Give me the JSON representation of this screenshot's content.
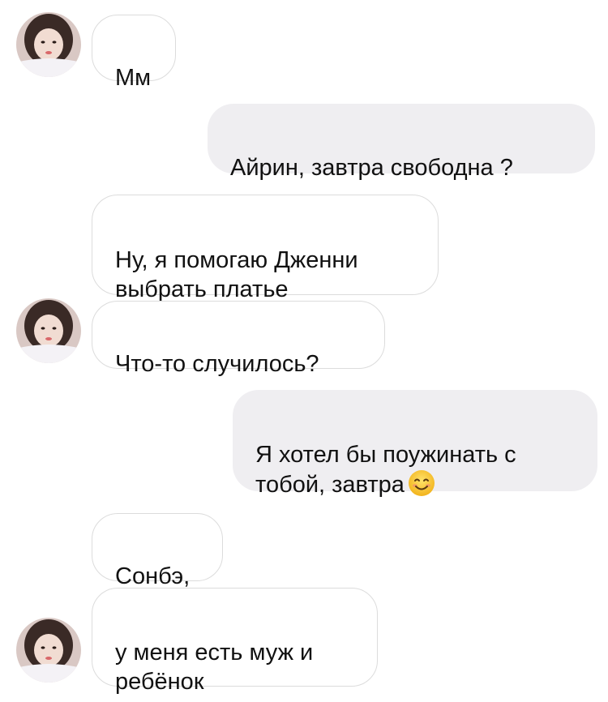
{
  "conversation": {
    "messages": [
      {
        "sender": "contact",
        "text": "Мм"
      },
      {
        "sender": "me",
        "text": "Айрин, завтра свободна ?"
      },
      {
        "sender": "contact",
        "text": "Ну, я помогаю Дженни\nвыбрать платье"
      },
      {
        "sender": "contact",
        "text": "Что-то случилось?"
      },
      {
        "sender": "me",
        "text": "Я хотел бы поужинать с\nтобой, завтра"
      },
      {
        "sender": "contact",
        "text": "Сонбэ,"
      },
      {
        "sender": "contact",
        "text": "у меня есть муж и\nребёнок"
      }
    ],
    "emoji": {
      "name": "smiling-face-emoji",
      "color": "#f7c928"
    }
  },
  "colors": {
    "incoming_bubble": "#ffffff",
    "incoming_border": "#dcdcdc",
    "outgoing_bubble": "#efeef1",
    "text": "#111111"
  },
  "icons": {
    "avatar": "contact-avatar-photo"
  }
}
